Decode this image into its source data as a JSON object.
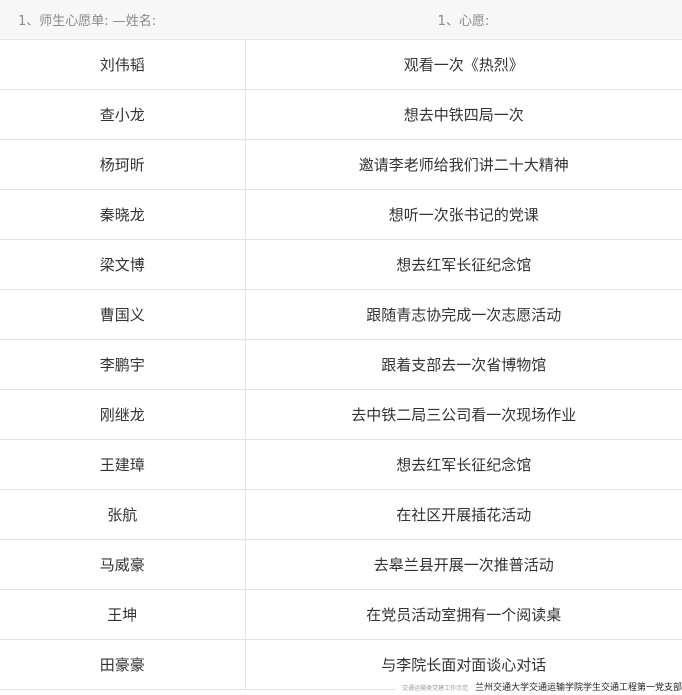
{
  "table": {
    "header_name": "1、师生心愿单: —姓名:",
    "header_wish": "1、心愿:",
    "rows": [
      {
        "name": "刘伟韬",
        "wish": "观看一次《热烈》"
      },
      {
        "name": "查小龙",
        "wish": "想去中铁四局一次"
      },
      {
        "name": "杨珂昕",
        "wish": "邀请李老师给我们讲二十大精神"
      },
      {
        "name": "秦晓龙",
        "wish": "想听一次张书记的党课"
      },
      {
        "name": "梁文博",
        "wish": "想去红军长征纪念馆"
      },
      {
        "name": "曹国义",
        "wish": "跟随青志协完成一次志愿活动"
      },
      {
        "name": "李鹏宇",
        "wish": "跟着支部去一次省博物馆"
      },
      {
        "name": "刚继龙",
        "wish": "去中铁二局三公司看一次现场作业"
      },
      {
        "name": "王建璋",
        "wish": "想去红军长征纪念馆"
      },
      {
        "name": "张航",
        "wish": "在社区开展插花活动"
      },
      {
        "name": "马威豪",
        "wish": "去皋兰县开展一次推普活动"
      },
      {
        "name": "王坤",
        "wish": "在党员活动室拥有一个阅读桌"
      },
      {
        "name": "田豪豪",
        "wish": "与李院长面对面谈心对话"
      }
    ]
  },
  "watermark": {
    "faint": "交通运输类党建工作示范",
    "text": "兰州交通大学交通运输学院学生交通工程第一党支部"
  }
}
